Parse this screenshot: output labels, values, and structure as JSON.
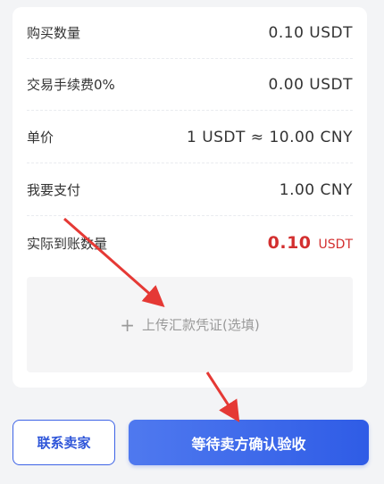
{
  "order": {
    "rows": [
      {
        "label": "购买数量",
        "value": "0.10 USDT"
      },
      {
        "label": "交易手续费0%",
        "value": "0.00 USDT"
      },
      {
        "label": "单价",
        "value": "1 USDT ≈ 10.00 CNY"
      },
      {
        "label": "我要支付",
        "value": "1.00 CNY"
      }
    ],
    "received": {
      "label": "实际到账数量",
      "amount": "0.10",
      "unit": "USDT"
    },
    "upload": {
      "plus": "+",
      "label": "上传汇款凭证(选填)"
    }
  },
  "actions": {
    "contact_label": "联系卖家",
    "confirm_label": "等待卖方确认验收"
  },
  "colors": {
    "accent": "#2f5ce6",
    "amount_red": "#d32f2f",
    "annotation_arrow": "#e53935"
  },
  "icons": [
    "plus-icon"
  ]
}
